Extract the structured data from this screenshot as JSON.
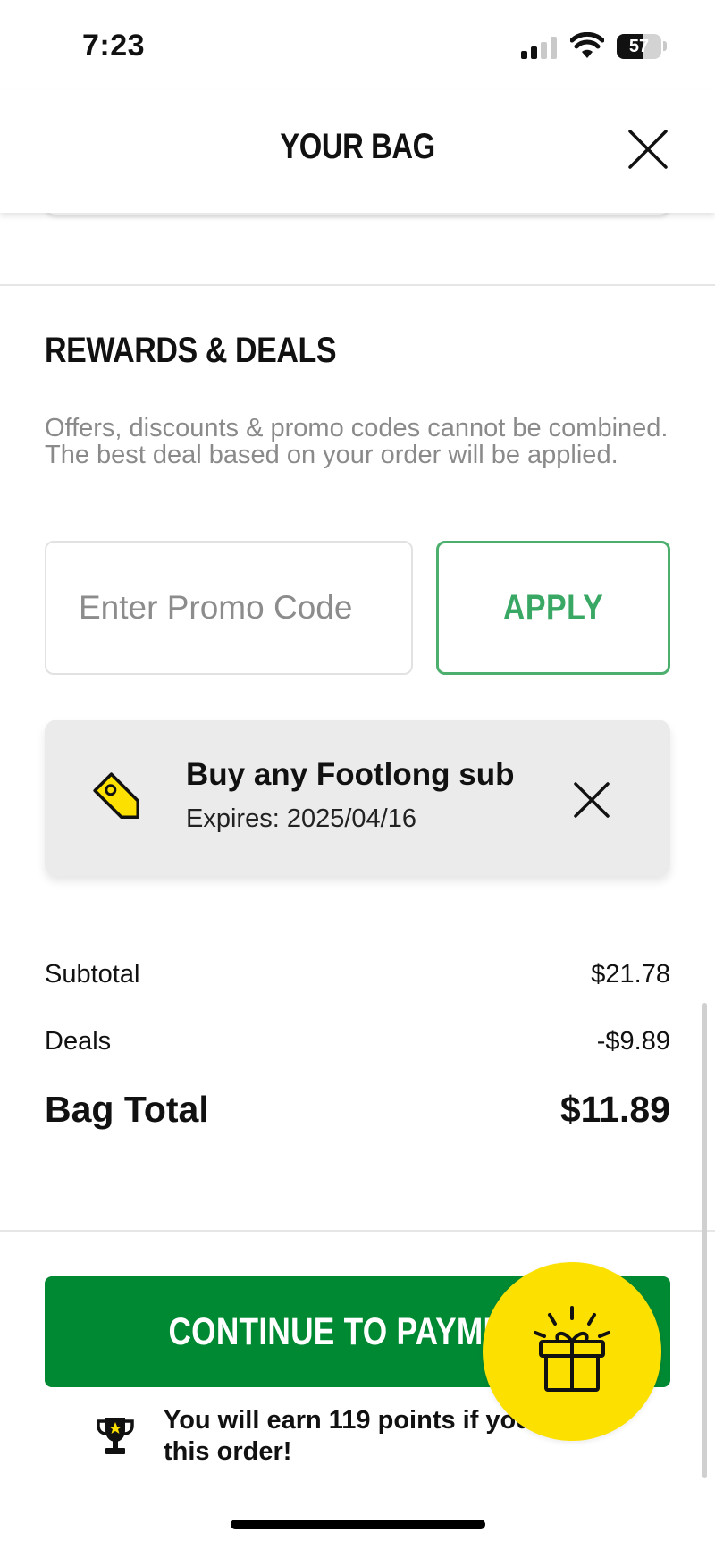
{
  "status_bar": {
    "time": "7:23",
    "battery_level": "57",
    "icons": [
      "cellular-signal-icon",
      "wifi-icon",
      "battery-icon"
    ]
  },
  "header": {
    "title": "YOUR BAG",
    "close_icon": "close-icon"
  },
  "rewards": {
    "title": "REWARDS & DEALS",
    "note": "Offers, discounts & promo codes cannot be combined. The best deal based on your order will be applied.",
    "promo_placeholder": "Enter Promo Code",
    "apply_label": "APPLY"
  },
  "applied_deal": {
    "icon": "tag-icon",
    "title": "Buy any Footlong sub",
    "expiry": "Expires: 2025/04/16",
    "remove_icon": "close-icon"
  },
  "summary": {
    "subtotal_label": "Subtotal",
    "subtotal_value": "$21.78",
    "deals_label": "Deals",
    "deals_value": "-$9.89",
    "total_label": "Bag Total",
    "total_value": "$11.89"
  },
  "checkout": {
    "continue_label": "CONTINUE TO PAYMENT",
    "points_message": "You will earn 119 points if you place this order!",
    "trophy_icon": "trophy-icon"
  },
  "rewards_fab": {
    "icon": "gift-icon"
  },
  "colors": {
    "brand_green": "#008933",
    "apply_green": "#3aa865",
    "fab_yellow": "#fce100",
    "tag_yellow": "#fce100"
  }
}
